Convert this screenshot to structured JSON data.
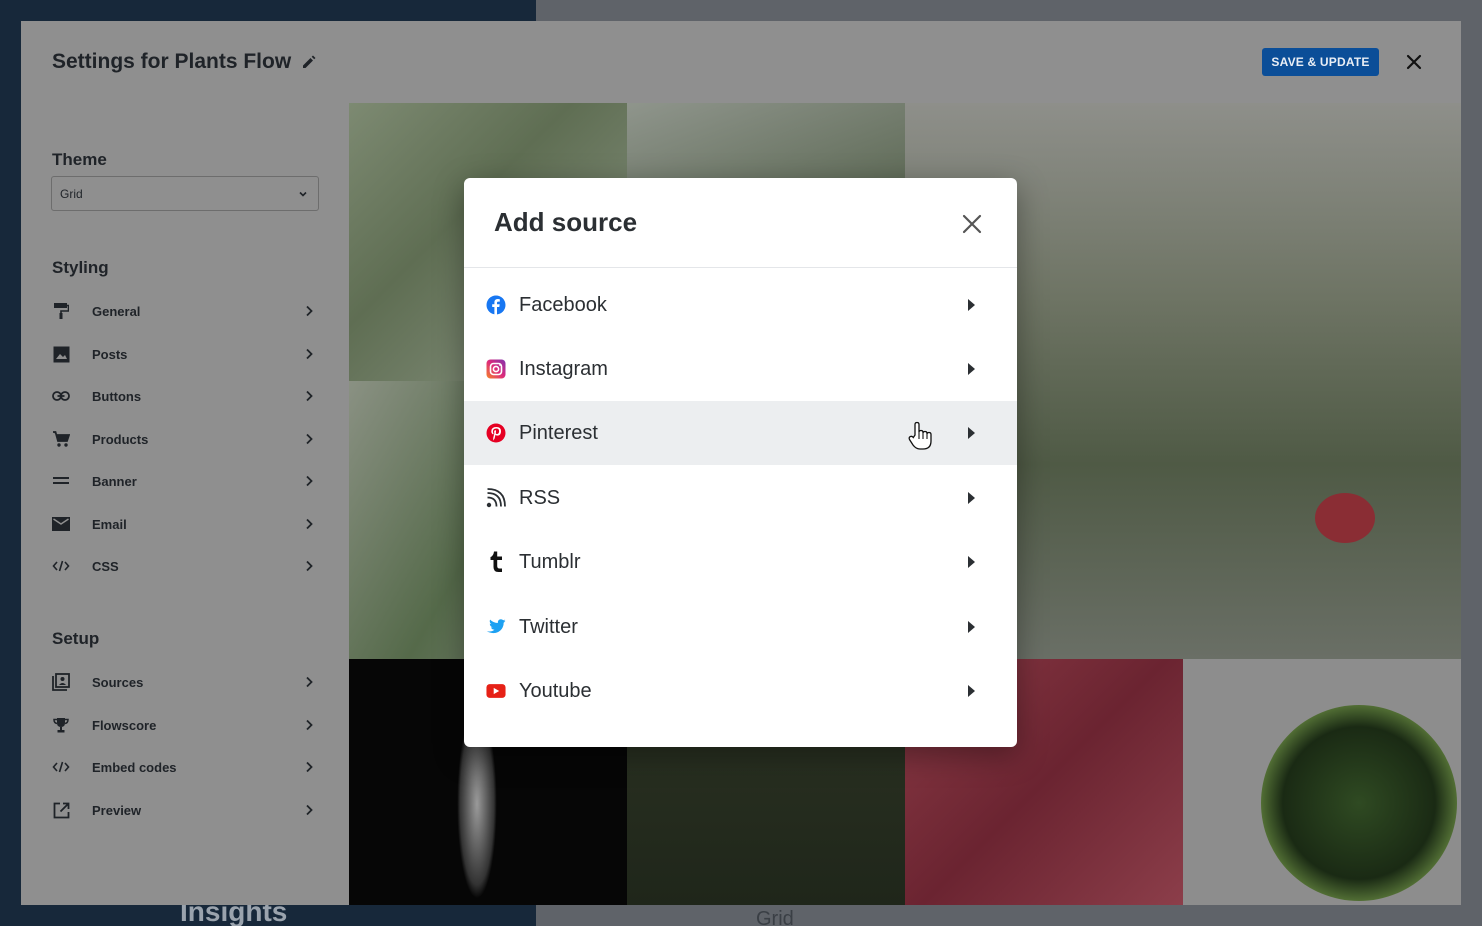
{
  "background": {
    "insights_label": "Insights",
    "grid_label": "Grid"
  },
  "settings": {
    "title": "Settings for Plants Flow",
    "save_label": "SAVE & UPDATE",
    "theme": {
      "heading": "Theme",
      "selected": "Grid"
    },
    "styling": {
      "heading": "Styling",
      "items": [
        {
          "label": "General",
          "icon": "paint-roller-icon"
        },
        {
          "label": "Posts",
          "icon": "image-icon"
        },
        {
          "label": "Buttons",
          "icon": "link-icon"
        },
        {
          "label": "Products",
          "icon": "cart-icon"
        },
        {
          "label": "Banner",
          "icon": "equals-icon"
        },
        {
          "label": "Email",
          "icon": "envelope-icon"
        },
        {
          "label": "CSS",
          "icon": "code-icon"
        }
      ]
    },
    "setup": {
      "heading": "Setup",
      "items": [
        {
          "label": "Sources",
          "icon": "sources-icon"
        },
        {
          "label": "Flowscore",
          "icon": "trophy-icon"
        },
        {
          "label": "Embed codes",
          "icon": "code-icon"
        },
        {
          "label": "Preview",
          "icon": "external-link-icon"
        }
      ]
    }
  },
  "modal": {
    "title": "Add source",
    "sources": [
      {
        "label": "Facebook",
        "icon": "facebook-icon",
        "color": "#1877f2"
      },
      {
        "label": "Instagram",
        "icon": "instagram-icon",
        "color": "#e1306c"
      },
      {
        "label": "Pinterest",
        "icon": "pinterest-icon",
        "color": "#e60023",
        "hovered": true
      },
      {
        "label": "RSS",
        "icon": "rss-icon",
        "color": "#2b2f33"
      },
      {
        "label": "Tumblr",
        "icon": "tumblr-icon",
        "color": "#111111"
      },
      {
        "label": "Twitter",
        "icon": "twitter-icon",
        "color": "#1da1f2"
      },
      {
        "label": "Youtube",
        "icon": "youtube-icon",
        "color": "#e62117"
      }
    ]
  },
  "colors": {
    "accent": "#0b4e98",
    "overlay": "#8f8f8f"
  }
}
